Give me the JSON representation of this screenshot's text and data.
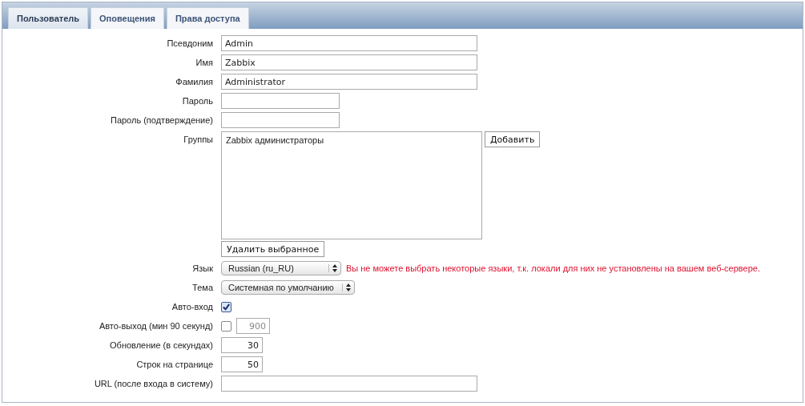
{
  "tabs": [
    {
      "label": "Пользователь",
      "selected": true
    },
    {
      "label": "Оповещения",
      "selected": false
    },
    {
      "label": "Права доступа",
      "selected": false
    }
  ],
  "fields": [
    {
      "kind": "text",
      "label": "Псевдоним",
      "value": "Admin"
    },
    {
      "kind": "text",
      "label": "Имя",
      "value": "Zabbix"
    },
    {
      "kind": "text",
      "label": "Фамилия",
      "value": "Administrator"
    },
    {
      "kind": "password",
      "label": "Пароль"
    },
    {
      "kind": "password",
      "label": "Пароль (подтверждение)"
    },
    {
      "kind": "list",
      "label": "Группы",
      "items": [
        "Zabbix администраторы"
      ],
      "add_button": "Добавить",
      "remove_button": "Удалить выбранное"
    },
    {
      "kind": "select",
      "label": "Язык",
      "value": "Russian (ru_RU)",
      "warning": "Вы не можете выбрать некоторые языки, т.к. локали для них не установлены на вашем веб-сервере."
    },
    {
      "kind": "select",
      "label": "Тема",
      "value": "Системная по умолчанию"
    },
    {
      "kind": "checkbox",
      "label": "Авто-вход",
      "checked": true
    },
    {
      "kind": "checknumber",
      "label": "Авто-выход (мин 90 секунд)",
      "checked": false,
      "value": "900",
      "disabled": true
    },
    {
      "kind": "number",
      "label": "Обновление (в секундах)",
      "value": "30"
    },
    {
      "kind": "number",
      "label": "Строк на странице",
      "value": "50"
    },
    {
      "kind": "text",
      "label": "URL (после входа в систему)"
    }
  ]
}
